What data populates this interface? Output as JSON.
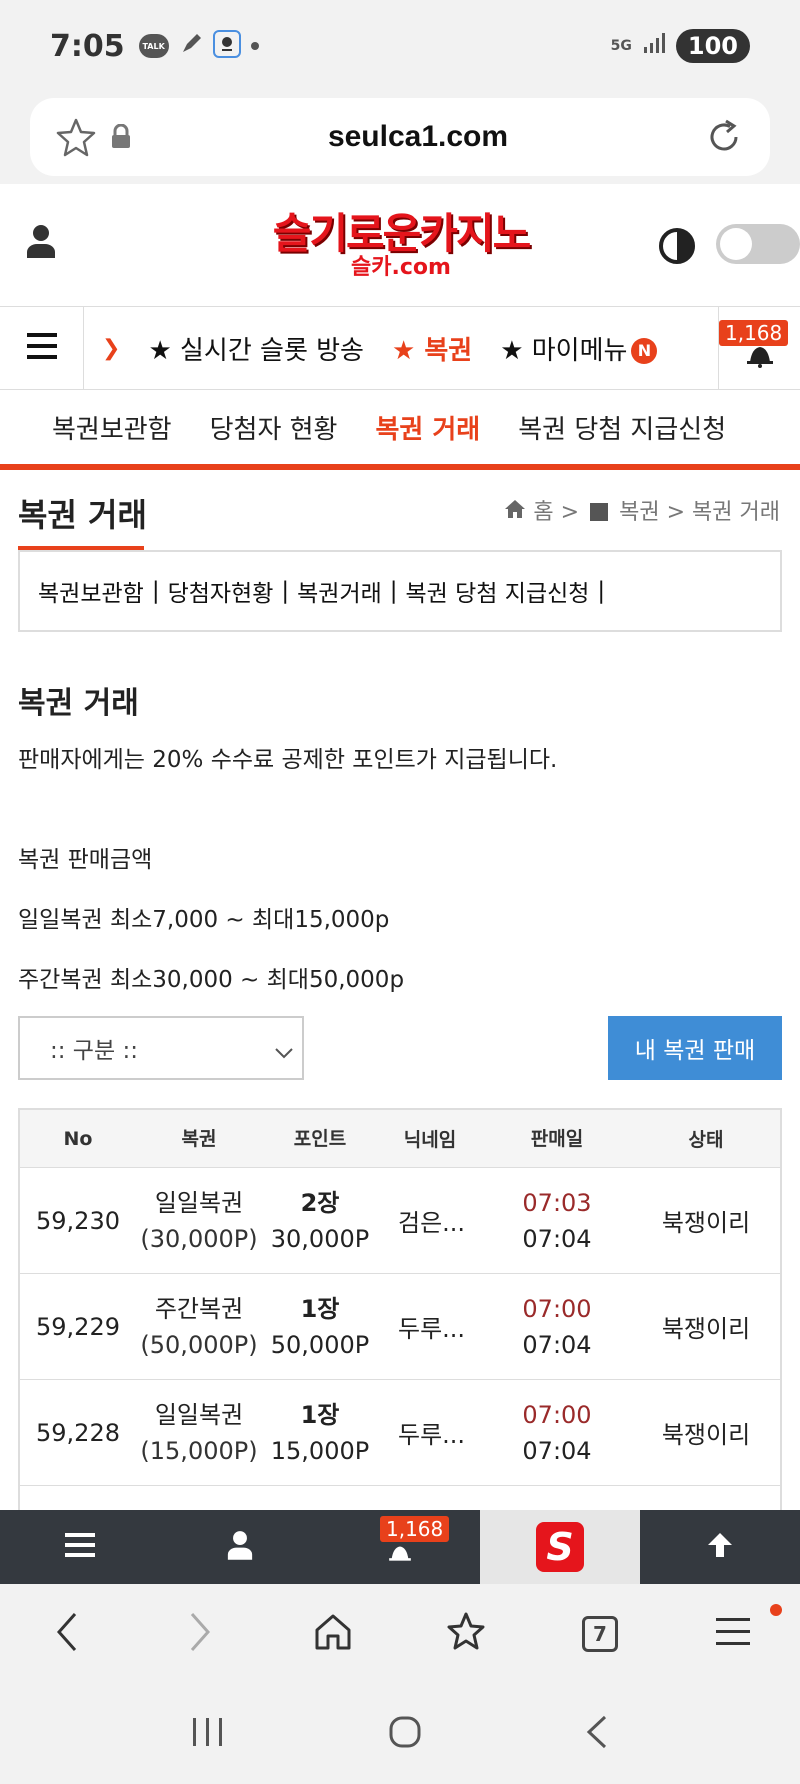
{
  "status_bar": {
    "time": "7:05",
    "talk_label": "TALK",
    "network": "5G",
    "battery": "100"
  },
  "browser": {
    "url": "seulca1.com",
    "tab_count": "7"
  },
  "site": {
    "logo_main": "슬기로운카지노",
    "logo_sub": "슬카.com",
    "brand_color": "#e5151c",
    "accent_color": "#e8411b"
  },
  "main_nav": {
    "items": [
      {
        "label": "★ 실시간 슬롯 방송"
      },
      {
        "label": "★ 복권"
      },
      {
        "label": "★ 마이메뉴"
      }
    ],
    "new_badge": "N",
    "notification_count": "1,168"
  },
  "sub_nav": {
    "items": [
      {
        "label": "복권보관함"
      },
      {
        "label": "당첨자 현황"
      },
      {
        "label": "복권 거래"
      },
      {
        "label": "복권 당첨 지급신청"
      }
    ]
  },
  "page": {
    "title": "복권 거래",
    "breadcrumb": {
      "home": "홈",
      "sep1": ">",
      "section": "복권",
      "sep2": ">",
      "current": "복권 거래"
    },
    "tabs": [
      {
        "label": "복권보관함"
      },
      {
        "label": "당첨자현황"
      },
      {
        "label": "복권거래"
      },
      {
        "label": "복권 당첨 지급신청"
      }
    ],
    "tab_sep": "|",
    "section_title": "복권 거래",
    "notice": "판매자에게는 20% 수수료 공제한 포인트가 지급됩니다.",
    "price_heading": "복권 판매금액",
    "daily_range": "일일복권 최소7,000 ~ 최대15,000p",
    "weekly_range": "주간복권 최소30,000 ~ 최대50,000p",
    "select_value": ":: 구분 ::",
    "sell_button": "내 복권 판매"
  },
  "table": {
    "headers": [
      "No",
      "복권",
      "포인트",
      "닉네임",
      "판매일",
      "상태"
    ],
    "rows": [
      {
        "no": "59,230",
        "ticket": "일일복권",
        "ticket_value": "(30,000P)",
        "qty": "2장",
        "points": "30,000P",
        "nickname": "검은...",
        "time_red": "07:03",
        "time": "07:04",
        "status": "북쟁이리"
      },
      {
        "no": "59,229",
        "ticket": "주간복권",
        "ticket_value": "(50,000P)",
        "qty": "1장",
        "points": "50,000P",
        "nickname": "두루...",
        "time_red": "07:00",
        "time": "07:04",
        "status": "북쟁이리"
      },
      {
        "no": "59,228",
        "ticket": "일일복권",
        "ticket_value": "(15,000P)",
        "qty": "1장",
        "points": "15,000P",
        "nickname": "두루...",
        "time_red": "07:00",
        "time": "07:04",
        "status": "북쟁이리"
      }
    ]
  },
  "site_toolbar": {
    "notification_count": "1,168",
    "logo_letter": "S"
  }
}
